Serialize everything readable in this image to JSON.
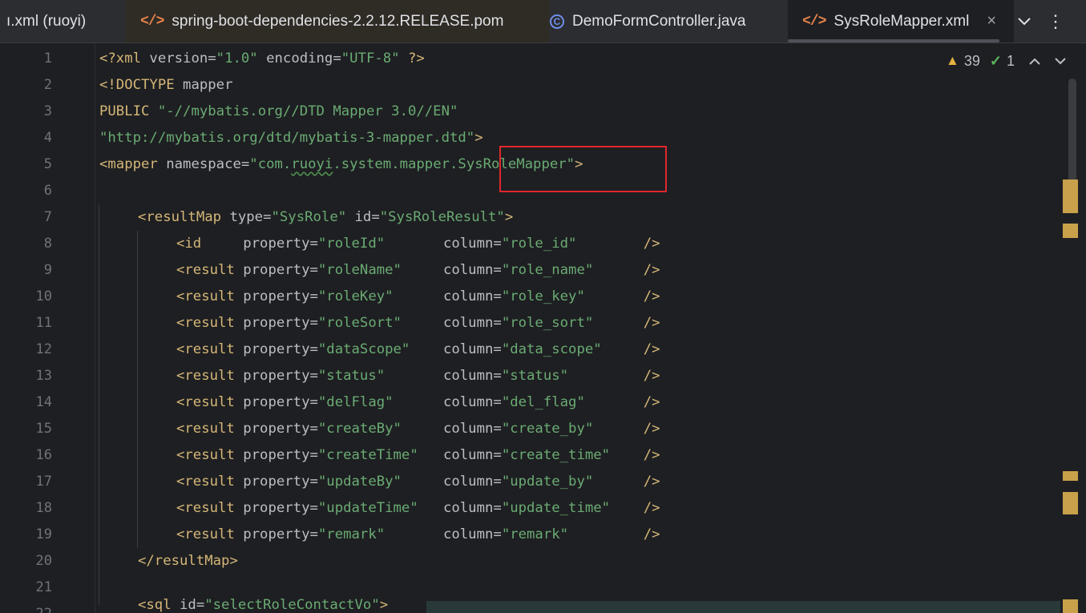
{
  "tabs": [
    {
      "label": "ı.xml (ruoyi)",
      "icon": "xml-file-icon"
    },
    {
      "label": "spring-boot-dependencies-2.2.12.RELEASE.pom",
      "icon": "xml-file-icon"
    },
    {
      "label": "DemoFormController.java",
      "icon": "java-class-icon"
    },
    {
      "label": "SysRoleMapper.xml",
      "icon": "xml-file-icon",
      "active": true
    }
  ],
  "tab_controls": {
    "close": "×",
    "dropdown": "⌄",
    "more": "⋮"
  },
  "inspections": {
    "warnings": "39",
    "weak_warnings": "1"
  },
  "line_numbers": [
    "1",
    "2",
    "3",
    "4",
    "5",
    "6",
    "7",
    "8",
    "9",
    "10",
    "11",
    "12",
    "13",
    "14",
    "15",
    "16",
    "17",
    "18",
    "19",
    "20",
    "21",
    "22"
  ],
  "code": {
    "l1": {
      "a": "<?xml",
      "b": " version=",
      "c": "\"1.0\"",
      "d": " encoding=",
      "e": "\"UTF-8\"",
      "f": " ?>"
    },
    "l2": {
      "a": "<!DOCTYPE",
      "b": " mapper"
    },
    "l3": {
      "a": "PUBLIC",
      "b": " ",
      "c": "\"-//mybatis.org//DTD Mapper 3.0//EN\""
    },
    "l4": {
      "a": "\"http://mybatis.org/dtd/mybatis-3-mapper.dtd\"",
      "b": ">"
    },
    "l5": {
      "a": "<mapper",
      "b": " namespace=",
      "c": "\"com.",
      "d": "ruoyi",
      "e": ".system.mapper.SysRoleMapper\"",
      "f": ">"
    },
    "l7": {
      "a": "<resultMap",
      "b": " type=",
      "c": "\"SysRole\"",
      "d": " id=",
      "e": "\"SysRoleResult\"",
      "f": ">"
    },
    "results": [
      {
        "tag": "<id    ",
        "prop": "\"roleId\"",
        "pad1": "       ",
        "col": "\"role_id\"",
        "pad2": "        ",
        "end": "/>"
      },
      {
        "tag": "<result",
        "prop": "\"roleName\"",
        "pad1": "     ",
        "col": "\"role_name\"",
        "pad2": "      ",
        "end": "/>"
      },
      {
        "tag": "<result",
        "prop": "\"roleKey\"",
        "pad1": "      ",
        "col": "\"role_key\"",
        "pad2": "       ",
        "end": "/>"
      },
      {
        "tag": "<result",
        "prop": "\"roleSort\"",
        "pad1": "     ",
        "col": "\"role_sort\"",
        "pad2": "      ",
        "end": "/>"
      },
      {
        "tag": "<result",
        "prop": "\"dataScope\"",
        "pad1": "    ",
        "col": "\"data_scope\"",
        "pad2": "     ",
        "end": "/>"
      },
      {
        "tag": "<result",
        "prop": "\"status\"",
        "pad1": "       ",
        "col": "\"status\"",
        "pad2": "         ",
        "end": "/>"
      },
      {
        "tag": "<result",
        "prop": "\"delFlag\"",
        "pad1": "      ",
        "col": "\"del_flag\"",
        "pad2": "       ",
        "end": "/>"
      },
      {
        "tag": "<result",
        "prop": "\"createBy\"",
        "pad1": "     ",
        "col": "\"create_by\"",
        "pad2": "      ",
        "end": "/>"
      },
      {
        "tag": "<result",
        "prop": "\"createTime\"",
        "pad1": "   ",
        "col": "\"create_time\"",
        "pad2": "    ",
        "end": "/>"
      },
      {
        "tag": "<result",
        "prop": "\"updateBy\"",
        "pad1": "     ",
        "col": "\"update_by\"",
        "pad2": "      ",
        "end": "/>"
      },
      {
        "tag": "<result",
        "prop": "\"updateTime\"",
        "pad1": "   ",
        "col": "\"update_time\"",
        "pad2": "    ",
        "end": "/>"
      },
      {
        "tag": "<result",
        "prop": "\"remark\"",
        "pad1": "       ",
        "col": "\"remark\"",
        "pad2": "         ",
        "end": "/>"
      }
    ],
    "kw_property": " property=",
    "kw_column": "column=",
    "l20": {
      "a": "</resultMap>"
    },
    "l22": {
      "a": "<sql",
      "b": " id=",
      "c": "\"selectRoleContactVo\"",
      "d": ">"
    }
  },
  "colors": {
    "tag": "#d5b778",
    "string": "#6aab73",
    "text": "#bcbec4",
    "highlight_box": "#e0272e"
  }
}
